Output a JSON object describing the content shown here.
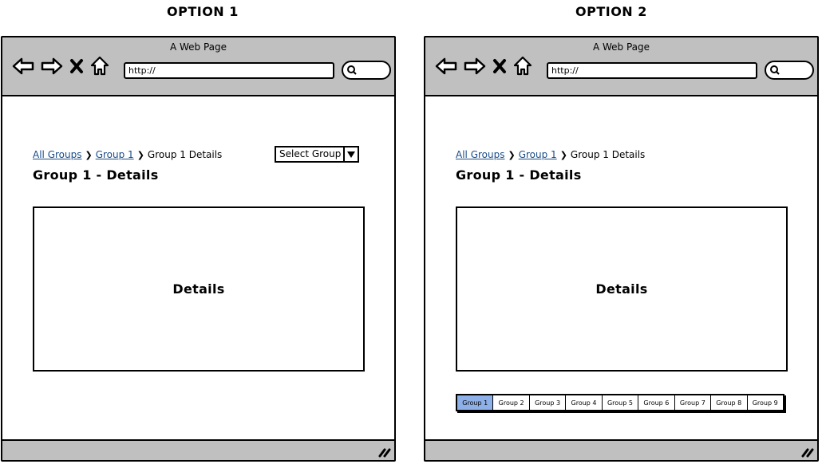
{
  "options": [
    {
      "heading": "OPTION 1",
      "window_title": "A Web Page",
      "url": "http://",
      "breadcrumb": [
        {
          "label": "All Groups",
          "link": true
        },
        {
          "label": "Group 1",
          "link": true
        },
        {
          "label": "Group 1 Details",
          "link": false
        }
      ],
      "page_title": "Group 1 - Details",
      "select": {
        "label": "Select Group"
      },
      "details_label": "Details"
    },
    {
      "heading": "OPTION 2",
      "window_title": "A Web Page",
      "url": "http://",
      "breadcrumb": [
        {
          "label": "All Groups",
          "link": true
        },
        {
          "label": "Group 1",
          "link": true
        },
        {
          "label": "Group 1 Details",
          "link": false
        }
      ],
      "page_title": "Group 1 - Details",
      "details_label": "Details",
      "tabs": [
        "Group 1",
        "Group 2",
        "Group 3",
        "Group 4",
        "Group 5",
        "Group 6",
        "Group 7",
        "Group 8",
        "Group 9"
      ],
      "active_tab": 0
    }
  ],
  "icons": {
    "back": "back-arrow-icon",
    "forward": "forward-arrow-icon",
    "stop": "close-x-icon",
    "home": "home-icon",
    "search": "search-icon",
    "resize": "resize-grip-icon"
  },
  "colors": {
    "chrome": "#c0c0c0",
    "link": "#1a4c8a",
    "active_tab": "#8eb0e8"
  }
}
